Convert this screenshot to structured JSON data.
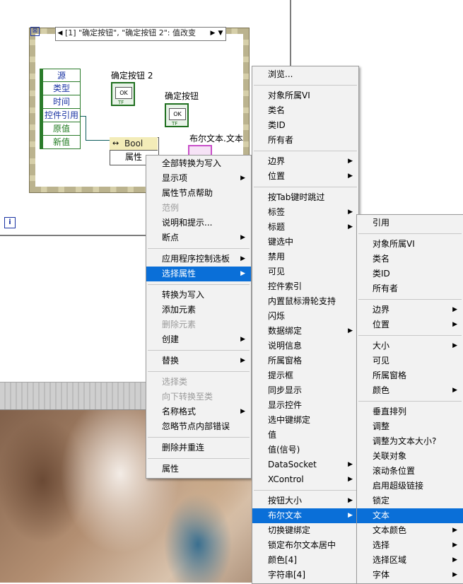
{
  "block_diagram": {
    "case_label": "[1] \"确定按钮\", \"确定按钮 2\": 值改变",
    "case_prev": "◀",
    "case_next": "▶",
    "case_dropdown": "▼",
    "event_data": [
      "源",
      "类型",
      "时间",
      "控件引用",
      "原值",
      "新值"
    ],
    "controls": [
      {
        "label": "确定按钮 2",
        "ok": "OK",
        "tf": "TF"
      },
      {
        "label": "确定按钮",
        "ok": "OK",
        "tf": "TF"
      }
    ],
    "pink_label": "布尔文本.文本",
    "property_node": {
      "arrow": "↔",
      "type": "Bool",
      "attr": "属性"
    },
    "info_icon": "i",
    "evt_icon": "⊠"
  },
  "menu1": {
    "items": [
      {
        "label": "全部转换为写入",
        "disabled": false,
        "submenu": false
      },
      {
        "label": "显示项",
        "disabled": false,
        "submenu": true
      },
      {
        "label": "属性节点帮助",
        "disabled": false,
        "submenu": false
      },
      {
        "label": "范例",
        "disabled": true,
        "submenu": false
      },
      {
        "label": "说明和提示...",
        "disabled": false,
        "submenu": false
      },
      {
        "label": "断点",
        "disabled": false,
        "submenu": true
      },
      {
        "sep": true
      },
      {
        "label": "应用程序控制选板",
        "disabled": false,
        "submenu": true
      },
      {
        "label": "选择属性",
        "disabled": false,
        "submenu": true,
        "selected": true
      },
      {
        "sep": true
      },
      {
        "label": "转换为写入",
        "disabled": false,
        "submenu": false
      },
      {
        "label": "添加元素",
        "disabled": false,
        "submenu": false
      },
      {
        "label": "删除元素",
        "disabled": true,
        "submenu": false
      },
      {
        "label": "创建",
        "disabled": false,
        "submenu": true
      },
      {
        "sep": true
      },
      {
        "label": "替换",
        "disabled": false,
        "submenu": true
      },
      {
        "sep": true
      },
      {
        "label": "选择类",
        "disabled": true,
        "submenu": false
      },
      {
        "label": "向下转换至类",
        "disabled": true,
        "submenu": false
      },
      {
        "label": "名称格式",
        "disabled": false,
        "submenu": true
      },
      {
        "label": "忽略节点内部错误",
        "disabled": false,
        "submenu": false
      },
      {
        "sep": true
      },
      {
        "label": "删除并重连",
        "disabled": false,
        "submenu": false
      },
      {
        "sep": true
      },
      {
        "label": "属性",
        "disabled": false,
        "submenu": false
      }
    ]
  },
  "menu2": {
    "items": [
      {
        "label": "浏览...",
        "submenu": false
      },
      {
        "sep": true
      },
      {
        "label": "对象所属VI",
        "submenu": false
      },
      {
        "label": "类名",
        "submenu": false
      },
      {
        "label": "类ID",
        "submenu": false
      },
      {
        "label": "所有者",
        "submenu": false
      },
      {
        "sep": true
      },
      {
        "label": "边界",
        "submenu": true
      },
      {
        "label": "位置",
        "submenu": true
      },
      {
        "sep": true
      },
      {
        "label": "按Tab键时跳过",
        "submenu": false
      },
      {
        "label": "标签",
        "submenu": true
      },
      {
        "label": "标题",
        "submenu": true
      },
      {
        "label": "键选中",
        "submenu": false
      },
      {
        "label": "禁用",
        "submenu": false
      },
      {
        "label": "可见",
        "submenu": false
      },
      {
        "label": "控件索引",
        "submenu": false
      },
      {
        "label": "内置鼠标滑轮支持",
        "submenu": false
      },
      {
        "label": "闪烁",
        "submenu": false
      },
      {
        "label": "数据绑定",
        "submenu": true
      },
      {
        "label": "说明信息",
        "submenu": false
      },
      {
        "label": "所属窗格",
        "submenu": false
      },
      {
        "label": "提示框",
        "submenu": false
      },
      {
        "label": "同步显示",
        "submenu": false
      },
      {
        "label": "显示控件",
        "submenu": false
      },
      {
        "label": "选中键绑定",
        "submenu": false
      },
      {
        "label": "值",
        "submenu": false
      },
      {
        "label": "值(信号)",
        "submenu": false
      },
      {
        "label": "DataSocket",
        "submenu": true
      },
      {
        "label": "XControl",
        "submenu": true
      },
      {
        "sep": true
      },
      {
        "label": "按钮大小",
        "submenu": true
      },
      {
        "label": "布尔文本",
        "submenu": true,
        "selected": true
      },
      {
        "label": "切换键绑定",
        "submenu": false
      },
      {
        "label": "锁定布尔文本居中",
        "submenu": false
      },
      {
        "label": "颜色[4]",
        "submenu": false
      },
      {
        "label": "字符串[4]",
        "submenu": false
      }
    ]
  },
  "menu3": {
    "items": [
      {
        "label": "引用",
        "submenu": false
      },
      {
        "sep": true
      },
      {
        "label": "对象所属VI",
        "submenu": false
      },
      {
        "label": "类名",
        "submenu": false
      },
      {
        "label": "类ID",
        "submenu": false
      },
      {
        "label": "所有者",
        "submenu": false
      },
      {
        "sep": true
      },
      {
        "label": "边界",
        "submenu": true
      },
      {
        "label": "位置",
        "submenu": true
      },
      {
        "sep": true
      },
      {
        "label": "大小",
        "submenu": true
      },
      {
        "label": "可见",
        "submenu": false
      },
      {
        "label": "所属窗格",
        "submenu": false
      },
      {
        "label": "颜色",
        "submenu": true
      },
      {
        "sep": true
      },
      {
        "label": "垂直排列",
        "submenu": false
      },
      {
        "label": "调整",
        "submenu": false
      },
      {
        "label": "调整为文本大小?",
        "submenu": false
      },
      {
        "label": "关联对象",
        "submenu": false
      },
      {
        "label": "滚动条位置",
        "submenu": false
      },
      {
        "label": "启用超级链接",
        "submenu": false
      },
      {
        "label": "锁定",
        "submenu": false
      },
      {
        "label": "文本",
        "submenu": false,
        "selected": true
      },
      {
        "label": "文本颜色",
        "submenu": true
      },
      {
        "label": "选择",
        "submenu": true
      },
      {
        "label": "选择区域",
        "submenu": true
      },
      {
        "label": "字体",
        "submenu": true
      }
    ]
  },
  "colors": {
    "selection": "#0a6fd8",
    "frame": "#d6cfa9",
    "wire": "#0d5c5c"
  }
}
